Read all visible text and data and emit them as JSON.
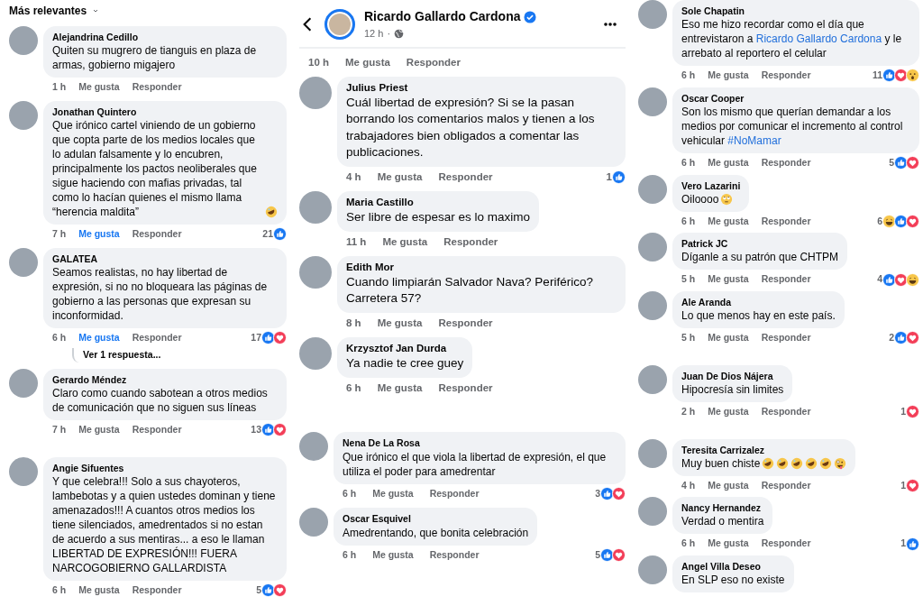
{
  "columns": [
    {
      "sort_menu": {
        "label": "Más relevantes"
      },
      "segments": [
        {
          "items": [
            {
              "kind": "comment",
              "author": "Alejandrina Cedillo",
              "text": "Quiten su mugrero de tianguis en plaza de armas, gobierno migajero",
              "time": "1 h",
              "like_label": "Me gusta",
              "reply_label": "Responder",
              "liked": false
            },
            {
              "kind": "comment",
              "author": "Jonathan Quintero",
              "text": "Que irónico cartel viniendo de un gobierno que copta parte de los medios locales que lo adulan falsamente y lo encubren, principalmente los pactos neoliberales que sigue haciendo con mafias privadas, tal como lo hacían quienes el mismo llama “herencia maldita”",
              "emojis": [
                {
                  "kind": "rofl"
                }
              ],
              "time": "7 h",
              "like_label": "Me gusta",
              "reply_label": "Responder",
              "liked": true,
              "count": "21",
              "reactions": [
                {
                  "kind": "like"
                }
              ]
            },
            {
              "kind": "comment",
              "author": "GALATEA",
              "text": "Seamos realistas, no hay libertad de expresión, si no no bloqueara las páginas de gobierno a las personas que expresan su inconformidad.",
              "time": "6 h",
              "like_label": "Me gusta",
              "reply_label": "Responder",
              "liked": true,
              "count": "17",
              "reactions": [
                {
                  "kind": "like"
                },
                {
                  "kind": "love"
                }
              ],
              "replies_link": "Ver 1 respuesta..."
            },
            {
              "kind": "comment",
              "author": "Gerardo Méndez",
              "text": "Claro como cuando sabotean a otros medios de comunicación que no siguen sus líneas",
              "time": "7 h",
              "like_label": "Me gusta",
              "reply_label": "Responder",
              "liked": false,
              "count": "13",
              "reactions": [
                {
                  "kind": "like"
                },
                {
                  "kind": "love"
                }
              ]
            }
          ]
        },
        {
          "items": [
            {
              "kind": "comment",
              "author": "Angie Sifuentes",
              "text": "Y que celebra!!! Solo a sus chayoteros, lambebotas y a quien   ustedes dominan y tiene amenazados!!! A cuantos otros medios los tiene silenciados, amedrentados si no estan de acuerdo a sus mentiras... a eso le llaman LIBERTAD DE EXPRESIÓN!!! FUERA NARCOGOBIERNO GALLARDISTA",
              "time": "6 h",
              "like_label": "Me gusta",
              "reply_label": "Responder",
              "liked": false,
              "count": "5",
              "reactions": [
                {
                  "kind": "like"
                },
                {
                  "kind": "love"
                }
              ]
            }
          ]
        }
      ]
    },
    {
      "post_header": {
        "author": "Ricardo Gallardo Cardona",
        "verified": true,
        "time": "12 h",
        "separator": "·"
      },
      "segments": [
        {
          "items": [
            {
              "kind": "meta",
              "time": "10 h",
              "like_label": "Me gusta",
              "reply_label": "Responder",
              "liked": false
            },
            {
              "kind": "comment",
              "author": "Julius Priest",
              "text": "Cuál libertad de expresión? Si se la pasan borrando los comentarios malos y tienen a los trabajadores bien obligados a comentar las publicaciones.",
              "time": "4 h",
              "like_label": "Me gusta",
              "reply_label": "Responder",
              "liked": false,
              "count": "1",
              "reactions": [
                {
                  "kind": "like"
                }
              ]
            },
            {
              "kind": "comment",
              "author": "Maria Castillo",
              "text": "Ser libre de espesar es lo maximo",
              "time": "11 h",
              "like_label": "Me gusta",
              "reply_label": "Responder",
              "liked": false
            },
            {
              "kind": "comment",
              "author": "Edith Mor",
              "text": "Cuando limpiarán Salvador Nava? Periférico? Carretera 57?",
              "time": "8 h",
              "like_label": "Me gusta",
              "reply_label": "Responder",
              "liked": false
            },
            {
              "kind": "comment",
              "author": "Krzysztof Jan Durda",
              "text": "Ya nadie te cree guey",
              "time": "6 h",
              "like_label": "Me gusta",
              "reply_label": "Responder",
              "liked": false
            }
          ]
        },
        {
          "items": [
            {
              "kind": "comment",
              "author": "Nena De La Rosa",
              "text": "Que irónico el que viola la libertad de expresión, el que utiliza el poder para amedrentar",
              "time": "6 h",
              "like_label": "Me gusta",
              "reply_label": "Responder",
              "liked": false,
              "count": "3",
              "reactions": [
                {
                  "kind": "like"
                },
                {
                  "kind": "love"
                }
              ]
            },
            {
              "kind": "comment",
              "author": "Oscar Esquivel",
              "text": "Amedrentando, que bonita celebración",
              "time": "6 h",
              "like_label": "Me gusta",
              "reply_label": "Responder",
              "liked": false,
              "count": "5",
              "reactions": [
                {
                  "kind": "like"
                },
                {
                  "kind": "love"
                }
              ]
            }
          ]
        }
      ]
    },
    {
      "segments": [
        {
          "items": [
            {
              "kind": "comment",
              "author": "Sole Chapatin",
              "parts": [
                {
                  "text": "Eso me hizo recordar como el día que entrevistaron a ",
                  "link": false
                },
                {
                  "text": "Ricardo Gallardo Cardona",
                  "link": true
                },
                {
                  "text": "  y le arrebato al reportero el celular",
                  "link": false
                }
              ],
              "time": "6 h",
              "like_label": "Me gusta",
              "reply_label": "Responder",
              "liked": false,
              "count": "11",
              "reactions": [
                {
                  "kind": "like"
                },
                {
                  "kind": "love"
                },
                {
                  "kind": "wow"
                }
              ]
            },
            {
              "kind": "comment",
              "author": "Oscar Cooper",
              "parts": [
                {
                  "text": "Son los mismo que querían demandar a los medios por comunicar el incremento al control vehicular ",
                  "link": false
                },
                {
                  "text": "#NoMamar",
                  "link": true
                }
              ],
              "time": "6 h",
              "like_label": "Me gusta",
              "reply_label": "Responder",
              "liked": false,
              "count": "5",
              "reactions": [
                {
                  "kind": "like"
                },
                {
                  "kind": "love"
                }
              ]
            },
            {
              "kind": "comment",
              "author": "Vero Lazarini",
              "text": "Oiloooo",
              "emojis": [
                {
                  "kind": "eyeroll"
                }
              ],
              "time": "6 h",
              "like_label": "Me gusta",
              "reply_label": "Responder",
              "liked": false,
              "count": "6",
              "reactions": [
                {
                  "kind": "haha"
                },
                {
                  "kind": "like"
                },
                {
                  "kind": "love"
                }
              ]
            },
            {
              "kind": "comment",
              "author": "Patrick JC",
              "text": "Díganle a su patrón que CHTPM",
              "time": "5 h",
              "like_label": "Me gusta",
              "reply_label": "Responder",
              "liked": false,
              "count": "4",
              "reactions": [
                {
                  "kind": "like"
                },
                {
                  "kind": "love"
                },
                {
                  "kind": "haha"
                }
              ]
            },
            {
              "kind": "comment",
              "author": "Ale Aranda",
              "text": "Lo que menos hay en este país.",
              "time": "5 h",
              "like_label": "Me gusta",
              "reply_label": "Responder",
              "liked": false,
              "count": "2",
              "reactions": [
                {
                  "kind": "like"
                },
                {
                  "kind": "love"
                }
              ]
            }
          ]
        },
        {
          "items": [
            {
              "kind": "comment",
              "author": "Juan De Dios Nájera",
              "text": "Hipocresía sin limites",
              "time": "2 h",
              "like_label": "Me gusta",
              "reply_label": "Responder",
              "liked": false,
              "count": "1",
              "reactions": [
                {
                  "kind": "love"
                }
              ]
            }
          ]
        },
        {
          "items": [
            {
              "kind": "comment",
              "author": "Teresita Carrizalez",
              "text": "Muy buen chiste",
              "emojis": [
                {
                  "kind": "rofl"
                },
                {
                  "kind": "rofl"
                },
                {
                  "kind": "rofl"
                },
                {
                  "kind": "rofl"
                },
                {
                  "kind": "rofl"
                },
                {
                  "kind": "zany"
                }
              ],
              "time": "4 h",
              "like_label": "Me gusta",
              "reply_label": "Responder",
              "liked": false,
              "count": "1",
              "reactions": [
                {
                  "kind": "love"
                }
              ]
            },
            {
              "kind": "comment",
              "author": "Nancy Hernandez",
              "text": "Verdad o mentira",
              "time": "6 h",
              "like_label": "Me gusta",
              "reply_label": "Responder",
              "liked": false,
              "count": "1",
              "reactions": [
                {
                  "kind": "like"
                }
              ]
            },
            {
              "kind": "comment",
              "author": "Angel Villa Deseo",
              "text": "En SLP eso no existe"
            }
          ]
        }
      ]
    }
  ]
}
